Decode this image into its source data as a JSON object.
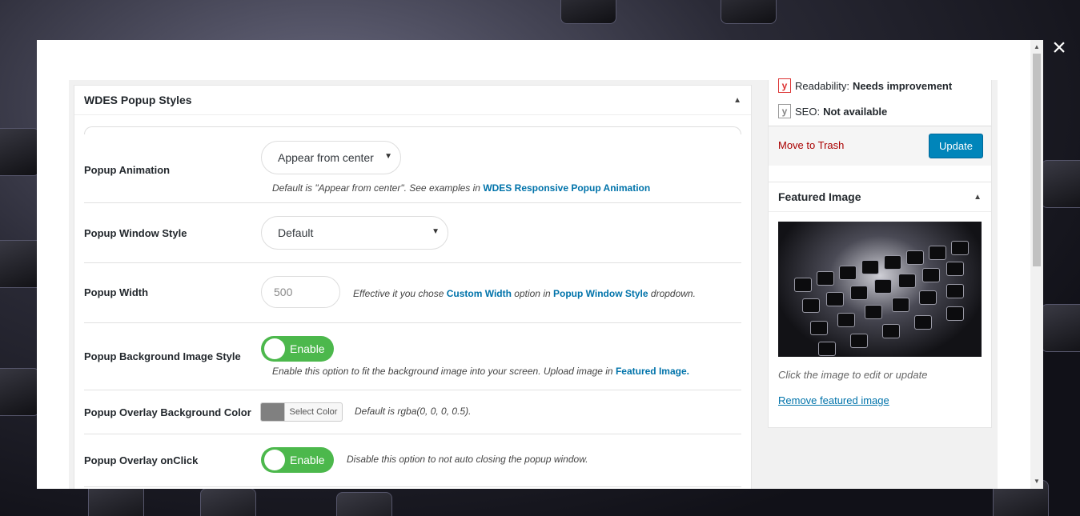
{
  "close_label": "×",
  "main_box": {
    "title": "WDES Popup Styles",
    "toggle": "▲",
    "rows": {
      "animation": {
        "label": "Popup Animation",
        "selected": "Appear from center",
        "desc_prefix": "Default is \"Appear from center\". See examples in ",
        "desc_link": "WDES Responsive Popup Animation"
      },
      "window_style": {
        "label": "Popup Window Style",
        "selected": "Default"
      },
      "width": {
        "label": "Popup Width",
        "placeholder": "500",
        "desc_1": "Effective it you chose ",
        "desc_link_1": "Custom Width",
        "desc_2": " option in ",
        "desc_link_2": "Popup Window Style",
        "desc_3": " dropdown."
      },
      "bg_image": {
        "label": "Popup Background Image Style",
        "switch_label": "Enable",
        "desc_prefix": "Enable this option to fit the background image into your screen. Upload image in ",
        "desc_link": "Featured Image."
      },
      "overlay_color": {
        "label": "Popup Overlay Background Color",
        "button_label": "Select Color",
        "swatch_color": "#808080",
        "desc": "Default is rgba(0, 0, 0, 0.5)."
      },
      "overlay_click": {
        "label": "Popup Overlay onClick",
        "switch_label": "Enable",
        "desc": "Disable this option to not auto closing the popup window."
      }
    }
  },
  "publish_box": {
    "readability_label": "Readability:",
    "readability_value": "Needs improvement",
    "seo_label": "SEO:",
    "seo_value": "Not available",
    "trash_label": "Move to Trash",
    "update_label": "Update"
  },
  "featured_box": {
    "title": "Featured Image",
    "toggle": "▲",
    "caption": "Click the image to edit or update",
    "remove_label": "Remove featured image"
  },
  "colors": {
    "accent": "#0085ba",
    "switch_on": "#4cb84c",
    "link": "#0073aa",
    "trash": "#aa0000"
  }
}
